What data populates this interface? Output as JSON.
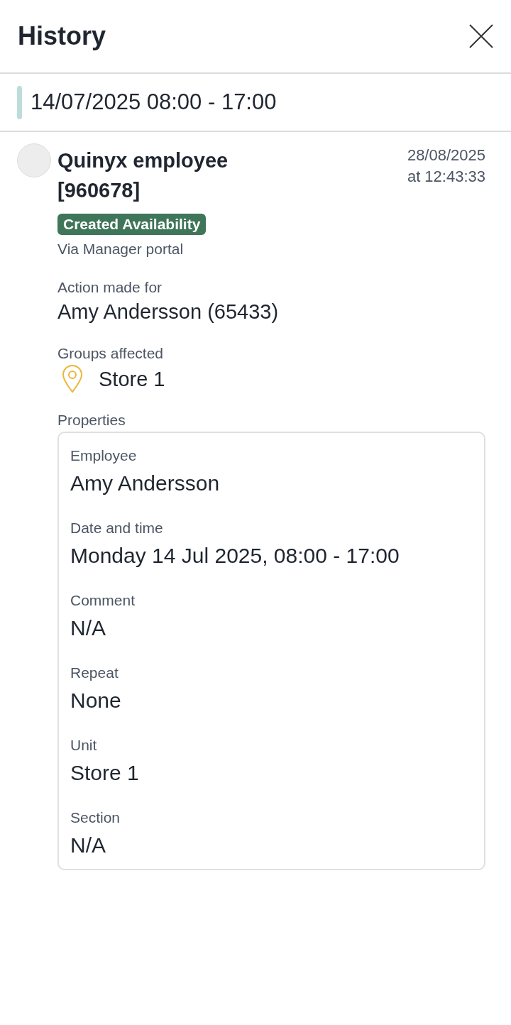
{
  "header": {
    "title": "History"
  },
  "shift": {
    "label": "14/07/2025 08:00 - 17:00"
  },
  "entry": {
    "author": "Quinyx employee [960678]",
    "date": "28/08/2025",
    "time": "at 12:43:33",
    "badge": "Created Availability",
    "source": "Via Manager portal",
    "sections": [
      {
        "kind": "text",
        "label": "Action made for",
        "value": "Amy Andersson (65433)"
      },
      {
        "kind": "location",
        "label": "Groups affected",
        "value": "Store 1"
      }
    ],
    "properties": {
      "label": "Properties",
      "fields": [
        {
          "label": "Employee",
          "value": "Amy Andersson"
        },
        {
          "label": "Date and time",
          "value": "Monday 14 Jul 2025, 08:00 - 17:00"
        },
        {
          "label": "Comment",
          "value": "N/A"
        },
        {
          "label": "Repeat",
          "value": "None"
        },
        {
          "label": "Unit",
          "value": "Store 1"
        },
        {
          "label": "Section",
          "value": "N/A"
        }
      ]
    }
  }
}
